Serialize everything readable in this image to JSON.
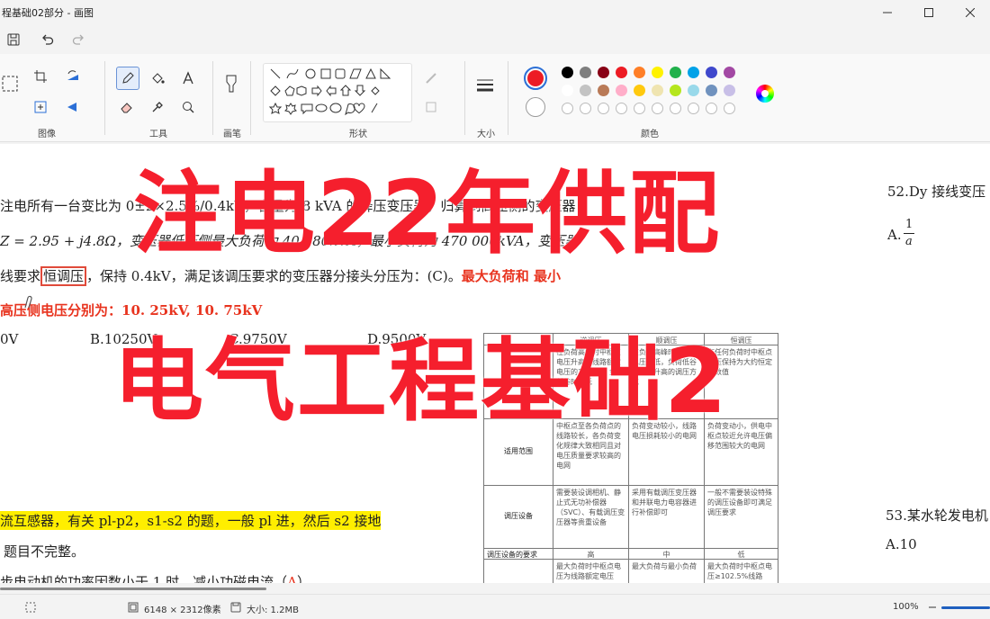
{
  "window": {
    "title": "程基础02部分 - 画图"
  },
  "ribbon": {
    "groups": {
      "image": "图像",
      "tools": "工具",
      "brushes": "画笔",
      "shapes": "形状",
      "size": "大小",
      "colors": "颜色"
    },
    "palette_row1": [
      "#000000",
      "#7f7f7f",
      "#880015",
      "#ed1c24",
      "#ff7f27",
      "#fff200",
      "#22b14c",
      "#00a2e8",
      "#3f48cc",
      "#a349a4"
    ],
    "palette_row2": [
      "#ffffff",
      "#c3c3c3",
      "#b97a57",
      "#ffaec9",
      "#ffc90e",
      "#efe4b0",
      "#b5e61d",
      "#99d9ea",
      "#7092be",
      "#c8bfe7"
    ],
    "color1": "#ed1c24",
    "color2": "#ffffff"
  },
  "doc": {
    "line1": "注电所有一台变比为 0±2×2.5%/0.4kV，容量为 8 kVA 的降压变压器，归算到高压侧的变压器",
    "line2": "Z   = 2.95 + j4.8Ω，变压器低压侧最大负荷为 40 180kVA，最小负荷为 470 000kVA，变压器",
    "line3_a": "线要求",
    "line3_box": "恒调压",
    "line3_b": "，保持 0.4kV，满足该调压要求的变压器分接头分压为：(C)。",
    "line3_red": "最大负荷和 最小",
    "line4_red": "高压侧电压分别为：10. 25kV, 10. 75kV",
    "opt_a": "0V",
    "opt_b": "B.10250V",
    "opt_c": "C.9750V",
    "opt_d": "D.9500V",
    "line5_hl": "流互感器，有关 pl-p2，s1-s2 的题，一般 pl 进，然后 s2 接地",
    "line6": "题目不完整。",
    "line7": "步电动机的功率因数小于 1 时，减小功磁电流（",
    "line7_ans": "A",
    "line7_end": "）",
    "right_q52": "52.Dy 接线变压",
    "right_a": "A.",
    "frac_num": "1",
    "frac_den": "a",
    "right_q53": "53.某水轮发电机",
    "right_a10": "A.10"
  },
  "table": {
    "header": [
      "",
      "逆调压",
      "顺调压",
      "恒调压"
    ],
    "row1": [
      "",
      "在负荷高峰时中枢点电压升高（线路额定电压的105%），负荷低谷时降低",
      "在负荷高峰时中枢点电压降低，负荷低谷时允许升高的调压方式",
      "在任何负荷时中枢点电压保持为大约恒定的数值"
    ],
    "row2": [
      "适用范围",
      "中枢点至各负荷点的线路较长，各负荷变化规律大致相同且对电压质量要求较高的电网",
      "负荷变动较小，线路电压损耗较小的电网",
      "负荷变动小，供电中枢点较近允许电压偏移范围较大的电网"
    ],
    "row3": [
      "调压设备",
      "需要装设调相机、静止式无功补偿器（SVC）、有载调压变压器等贵重设备",
      "采用有载调压变压器和并联电力电容器进行补偿即可",
      "一般不需要装设特殊的调压设备即可满足调压要求"
    ],
    "row4": [
      "调压设备的要求",
      "高",
      "中",
      "低"
    ],
    "row5": [
      "",
      "最大负荷时中枢点电压为线路额定电压",
      "最大负荷与最小负荷",
      "最大负荷时中枢点电压≥102.5%线路"
    ]
  },
  "overlay": {
    "line1": "注电22年供配",
    "line2": "电气工程基础2",
    "color": "#f51f2d"
  },
  "status": {
    "dimensions": "6148 × 2312像素",
    "size": "大小: 1.2MB",
    "zoom": "100%"
  }
}
